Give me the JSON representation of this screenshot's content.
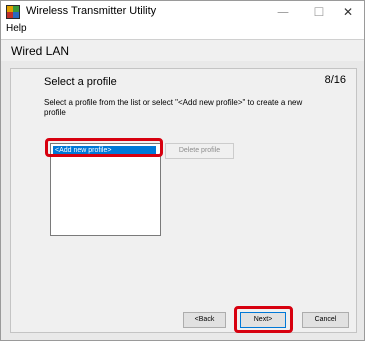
{
  "window": {
    "title": "Wireless Transmitter Utility",
    "minimize_glyph": "—",
    "maximize_glyph": "☐",
    "close_glyph": "✕"
  },
  "menu": {
    "help": "Help"
  },
  "header": {
    "title": "Wired LAN"
  },
  "panel": {
    "title": "Select a profile",
    "page_counter": "8/16",
    "instructions": "Select a profile from the list or select \"<Add new profile>\" to create a new profile"
  },
  "profiles": {
    "items": [
      "<Add new profile>"
    ],
    "selected": "<Add new profile>"
  },
  "buttons": {
    "delete": "Delete profile",
    "back": "<Back",
    "next": "Next>",
    "cancel": "Cancel"
  },
  "colors": {
    "highlight_red": "#d7000f",
    "selection_blue": "#0078d7"
  },
  "icons": {
    "app": "app-logo-icon"
  }
}
